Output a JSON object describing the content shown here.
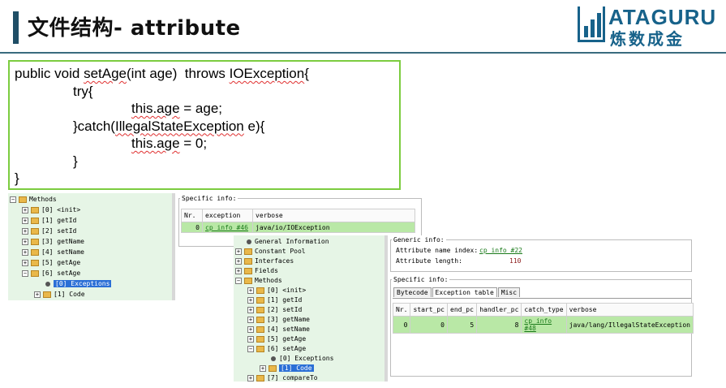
{
  "slide": {
    "title": "文件结构- attribute",
    "logo_top": "ATAGURU",
    "logo_bottom": "炼数成金"
  },
  "code": [
    {
      "indent": 0,
      "parts": [
        {
          "t": "public void "
        },
        {
          "t": "setAge",
          "sq": true
        },
        {
          "t": "(int age)  throws "
        },
        {
          "t": "IOException",
          "sq": true
        },
        {
          "t": "{"
        }
      ]
    },
    {
      "indent": 1,
      "parts": [
        {
          "t": "try{"
        }
      ]
    },
    {
      "indent": 2,
      "parts": [
        {
          "t": "this.age",
          "sq": true
        },
        {
          "t": " = age;"
        }
      ]
    },
    {
      "indent": 1,
      "parts": [
        {
          "t": "}catch("
        },
        {
          "t": "IllegalStateException",
          "sq": true
        },
        {
          "t": " e){"
        }
      ]
    },
    {
      "indent": 2,
      "parts": [
        {
          "t": "this.age",
          "sq": true
        },
        {
          "t": " = 0;"
        }
      ]
    },
    {
      "indent": 1,
      "parts": [
        {
          "t": "}"
        }
      ]
    },
    {
      "indent": 0,
      "parts": [
        {
          "t": "}"
        }
      ]
    }
  ],
  "panel1": {
    "tree": [
      {
        "label": "Methods",
        "level": 0,
        "toggle": "−",
        "type": "folder"
      },
      {
        "label": "[0] <init>",
        "level": 1,
        "toggle": "+",
        "type": "folder"
      },
      {
        "label": "[1] getId",
        "level": 1,
        "toggle": "+",
        "type": "folder"
      },
      {
        "label": "[2] setId",
        "level": 1,
        "toggle": "+",
        "type": "folder"
      },
      {
        "label": "[3] getName",
        "level": 1,
        "toggle": "+",
        "type": "folder"
      },
      {
        "label": "[4] setName",
        "level": 1,
        "toggle": "+",
        "type": "folder"
      },
      {
        "label": "[5] getAge",
        "level": 1,
        "toggle": "+",
        "type": "folder"
      },
      {
        "label": "[6] setAge",
        "level": 1,
        "toggle": "−",
        "type": "folder"
      },
      {
        "label": "[0] Exceptions",
        "level": 2,
        "toggle": "",
        "type": "leaf",
        "selected": true
      },
      {
        "label": "[1] Code",
        "level": 2,
        "toggle": "+",
        "type": "folder"
      }
    ],
    "specific_info_label": "Specific info:",
    "table": {
      "headers": [
        "Nr.",
        "exception",
        "verbose"
      ],
      "rows": [
        [
          "0",
          "cp info #46",
          "java/io/IOException"
        ]
      ]
    }
  },
  "panel2": {
    "tree": [
      {
        "label": "General Information",
        "level": 0,
        "toggle": "",
        "type": "leaf"
      },
      {
        "label": "Constant Pool",
        "level": 0,
        "toggle": "+",
        "type": "folder"
      },
      {
        "label": "Interfaces",
        "level": 0,
        "toggle": "+",
        "type": "folder"
      },
      {
        "label": "Fields",
        "level": 0,
        "toggle": "+",
        "type": "folder"
      },
      {
        "label": "Methods",
        "level": 0,
        "toggle": "−",
        "type": "folder"
      },
      {
        "label": "[0] <init>",
        "level": 1,
        "toggle": "+",
        "type": "folder"
      },
      {
        "label": "[1] getId",
        "level": 1,
        "toggle": "+",
        "type": "folder"
      },
      {
        "label": "[2] setId",
        "level": 1,
        "toggle": "+",
        "type": "folder"
      },
      {
        "label": "[3] getName",
        "level": 1,
        "toggle": "+",
        "type": "folder"
      },
      {
        "label": "[4] setName",
        "level": 1,
        "toggle": "+",
        "type": "folder"
      },
      {
        "label": "[5] getAge",
        "level": 1,
        "toggle": "+",
        "type": "folder"
      },
      {
        "label": "[6] setAge",
        "level": 1,
        "toggle": "−",
        "type": "folder"
      },
      {
        "label": "[0] Exceptions",
        "level": 2,
        "toggle": "",
        "type": "leaf"
      },
      {
        "label": "[1] Code",
        "level": 2,
        "toggle": "+",
        "type": "folder",
        "selected": true
      },
      {
        "label": "[7] compareTo",
        "level": 1,
        "toggle": "+",
        "type": "folder"
      }
    ],
    "generic_info_label": "Generic info:",
    "attr_name_index_label": "Attribute name index:",
    "attr_name_index_value": "cp info #22",
    "attr_length_label": "Attribute length:",
    "attr_length_value": "110",
    "specific_info_label": "Specific info:",
    "tabs": [
      "Bytecode",
      "Exception table",
      "Misc"
    ],
    "active_tab": 1,
    "table": {
      "headers": [
        "Nr.",
        "start_pc",
        "end_pc",
        "handler_pc",
        "catch_type",
        "verbose"
      ],
      "rows": [
        [
          "0",
          "0",
          "5",
          "8",
          "cp info #48",
          "java/lang/IllegalStateException"
        ]
      ]
    }
  },
  "colors": {
    "accent": "#1f4e66",
    "code_border": "#7ccc3f",
    "tree_bg": "#e6f5e6",
    "row_highlight": "#b9e8a6",
    "selection": "#2b6fd6"
  }
}
